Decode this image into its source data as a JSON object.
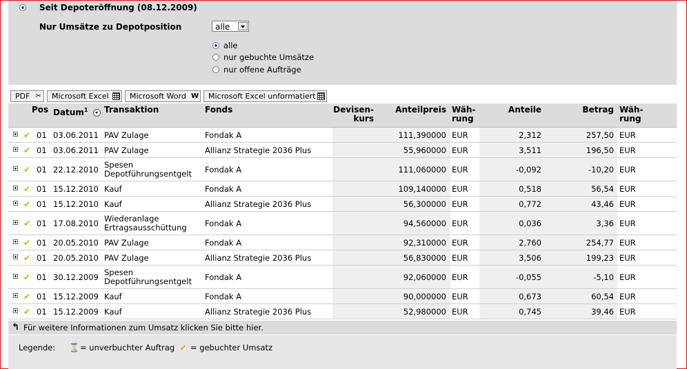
{
  "filter": {
    "main_label": "Seit Depoteröffnung (08.12.2009)",
    "position_label": "Nur Umsätze zu Depotposition",
    "position_value": "alle",
    "options": [
      "alle",
      "nur gebuchte Umsätze",
      "nur offene Aufträge"
    ]
  },
  "toolbar": {
    "pdf": "PDF",
    "excel": "Microsoft Excel",
    "word": "Microsoft Word",
    "excel_unformatted": "Microsoft Excel unformatiert"
  },
  "table": {
    "headers": {
      "pos": "Pos",
      "datum": "Datum",
      "datum_sup": "1",
      "transaktion": "Transaktion",
      "fonds": "Fonds",
      "devisen1": "Devisen-",
      "devisen2": "kurs",
      "anteilpreis": "Anteilpreis",
      "waehrung1": "Wäh-",
      "waehrung2": "rung",
      "anteile": "Anteile",
      "betrag": "Betrag",
      "waehrung3": "Wäh-",
      "waehrung4": "rung"
    },
    "rows": [
      {
        "pos": "01",
        "datum": "03.06.2011",
        "t1": "PAV Zulage",
        "t2": "",
        "fonds": "Fondak A",
        "preis": "111,390000",
        "cur1": "EUR",
        "anteile": "2,312",
        "betrag": "257,50",
        "cur2": "EUR"
      },
      {
        "pos": "01",
        "datum": "03.06.2011",
        "t1": "PAV Zulage",
        "t2": "",
        "fonds": "Allianz Strategie 2036 Plus",
        "preis": "55,960000",
        "cur1": "EUR",
        "anteile": "3,511",
        "betrag": "196,50",
        "cur2": "EUR"
      },
      {
        "pos": "01",
        "datum": "22.12.2010",
        "t1": "Spesen",
        "t2": "Depotführungsentgelt",
        "fonds": "Fondak A",
        "preis": "111,060000",
        "cur1": "EUR",
        "anteile": "-0,092",
        "betrag": "-10,20",
        "cur2": "EUR"
      },
      {
        "pos": "01",
        "datum": "15.12.2010",
        "t1": "Kauf",
        "t2": "",
        "fonds": "Fondak A",
        "preis": "109,140000",
        "cur1": "EUR",
        "anteile": "0,518",
        "betrag": "56,54",
        "cur2": "EUR"
      },
      {
        "pos": "01",
        "datum": "15.12.2010",
        "t1": "Kauf",
        "t2": "",
        "fonds": "Allianz Strategie 2036 Plus",
        "preis": "56,300000",
        "cur1": "EUR",
        "anteile": "0,772",
        "betrag": "43,46",
        "cur2": "EUR"
      },
      {
        "pos": "01",
        "datum": "17.08.2010",
        "t1": "Wiederanlage",
        "t2": "Ertragsausschüttung",
        "fonds": "Fondak A",
        "preis": "94,560000",
        "cur1": "EUR",
        "anteile": "0,036",
        "betrag": "3,36",
        "cur2": "EUR"
      },
      {
        "pos": "01",
        "datum": "20.05.2010",
        "t1": "PAV Zulage",
        "t2": "",
        "fonds": "Fondak A",
        "preis": "92,310000",
        "cur1": "EUR",
        "anteile": "2,760",
        "betrag": "254,77",
        "cur2": "EUR"
      },
      {
        "pos": "01",
        "datum": "20.05.2010",
        "t1": "PAV Zulage",
        "t2": "",
        "fonds": "Allianz Strategie 2036 Plus",
        "preis": "56,830000",
        "cur1": "EUR",
        "anteile": "3,506",
        "betrag": "199,23",
        "cur2": "EUR"
      },
      {
        "pos": "01",
        "datum": "30.12.2009",
        "t1": "Spesen",
        "t2": "Depotführungsentgelt",
        "fonds": "Fondak A",
        "preis": "92,060000",
        "cur1": "EUR",
        "anteile": "-0,055",
        "betrag": "-5,10",
        "cur2": "EUR"
      },
      {
        "pos": "01",
        "datum": "15.12.2009",
        "t1": "Kauf",
        "t2": "",
        "fonds": "Fondak A",
        "preis": "90,000000",
        "cur1": "EUR",
        "anteile": "0,673",
        "betrag": "60,54",
        "cur2": "EUR"
      },
      {
        "pos": "01",
        "datum": "15.12.2009",
        "t1": "Kauf",
        "t2": "",
        "fonds": "Allianz Strategie 2036 Plus",
        "preis": "52,980000",
        "cur1": "EUR",
        "anteile": "0,745",
        "betrag": "39,46",
        "cur2": "EUR"
      }
    ]
  },
  "info_text": "Für weitere Informationen zum Umsatz klicken Sie bitte hier.",
  "legend": {
    "label": "Legende:",
    "open_text": "= unverbuchter Auftrag",
    "booked_text": "= gebuchter Umsatz"
  },
  "colors": {
    "accent": "#e5a600",
    "frame": "#e01010",
    "panel": "#dcdcdc"
  }
}
